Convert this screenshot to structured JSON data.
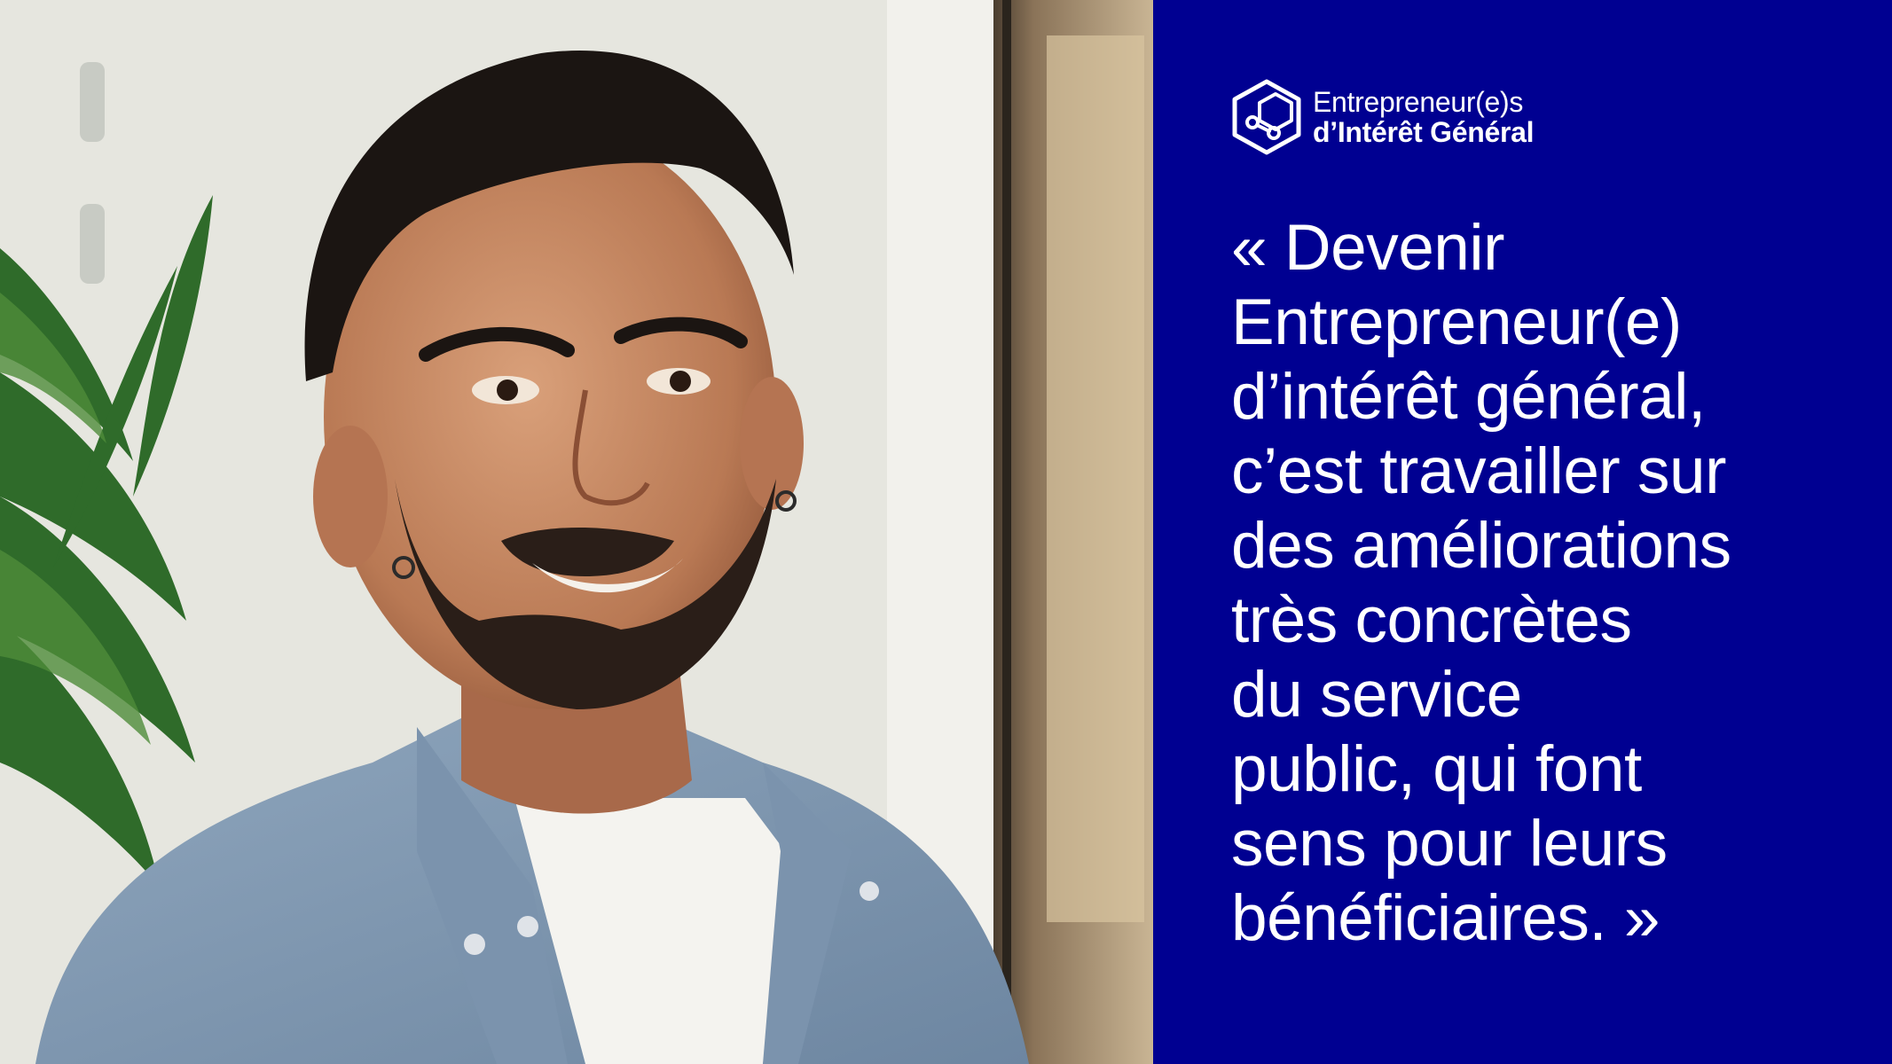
{
  "brand": {
    "line1": "Entrepreneur(e)s",
    "line2": "d’Intérêt Général",
    "logo_icon": "hexagon-network-icon"
  },
  "quote": {
    "text": "« Devenir\nEntrepreneur(e)\nd’intérêt général,\nc’est travailler sur\ndes améliorations\ntrès concrètes\ndu service\npublic, qui font\nsens pour leurs\nbénéficiaires. »"
  },
  "colors": {
    "panel_background": "#000091",
    "text": "#ffffff"
  }
}
